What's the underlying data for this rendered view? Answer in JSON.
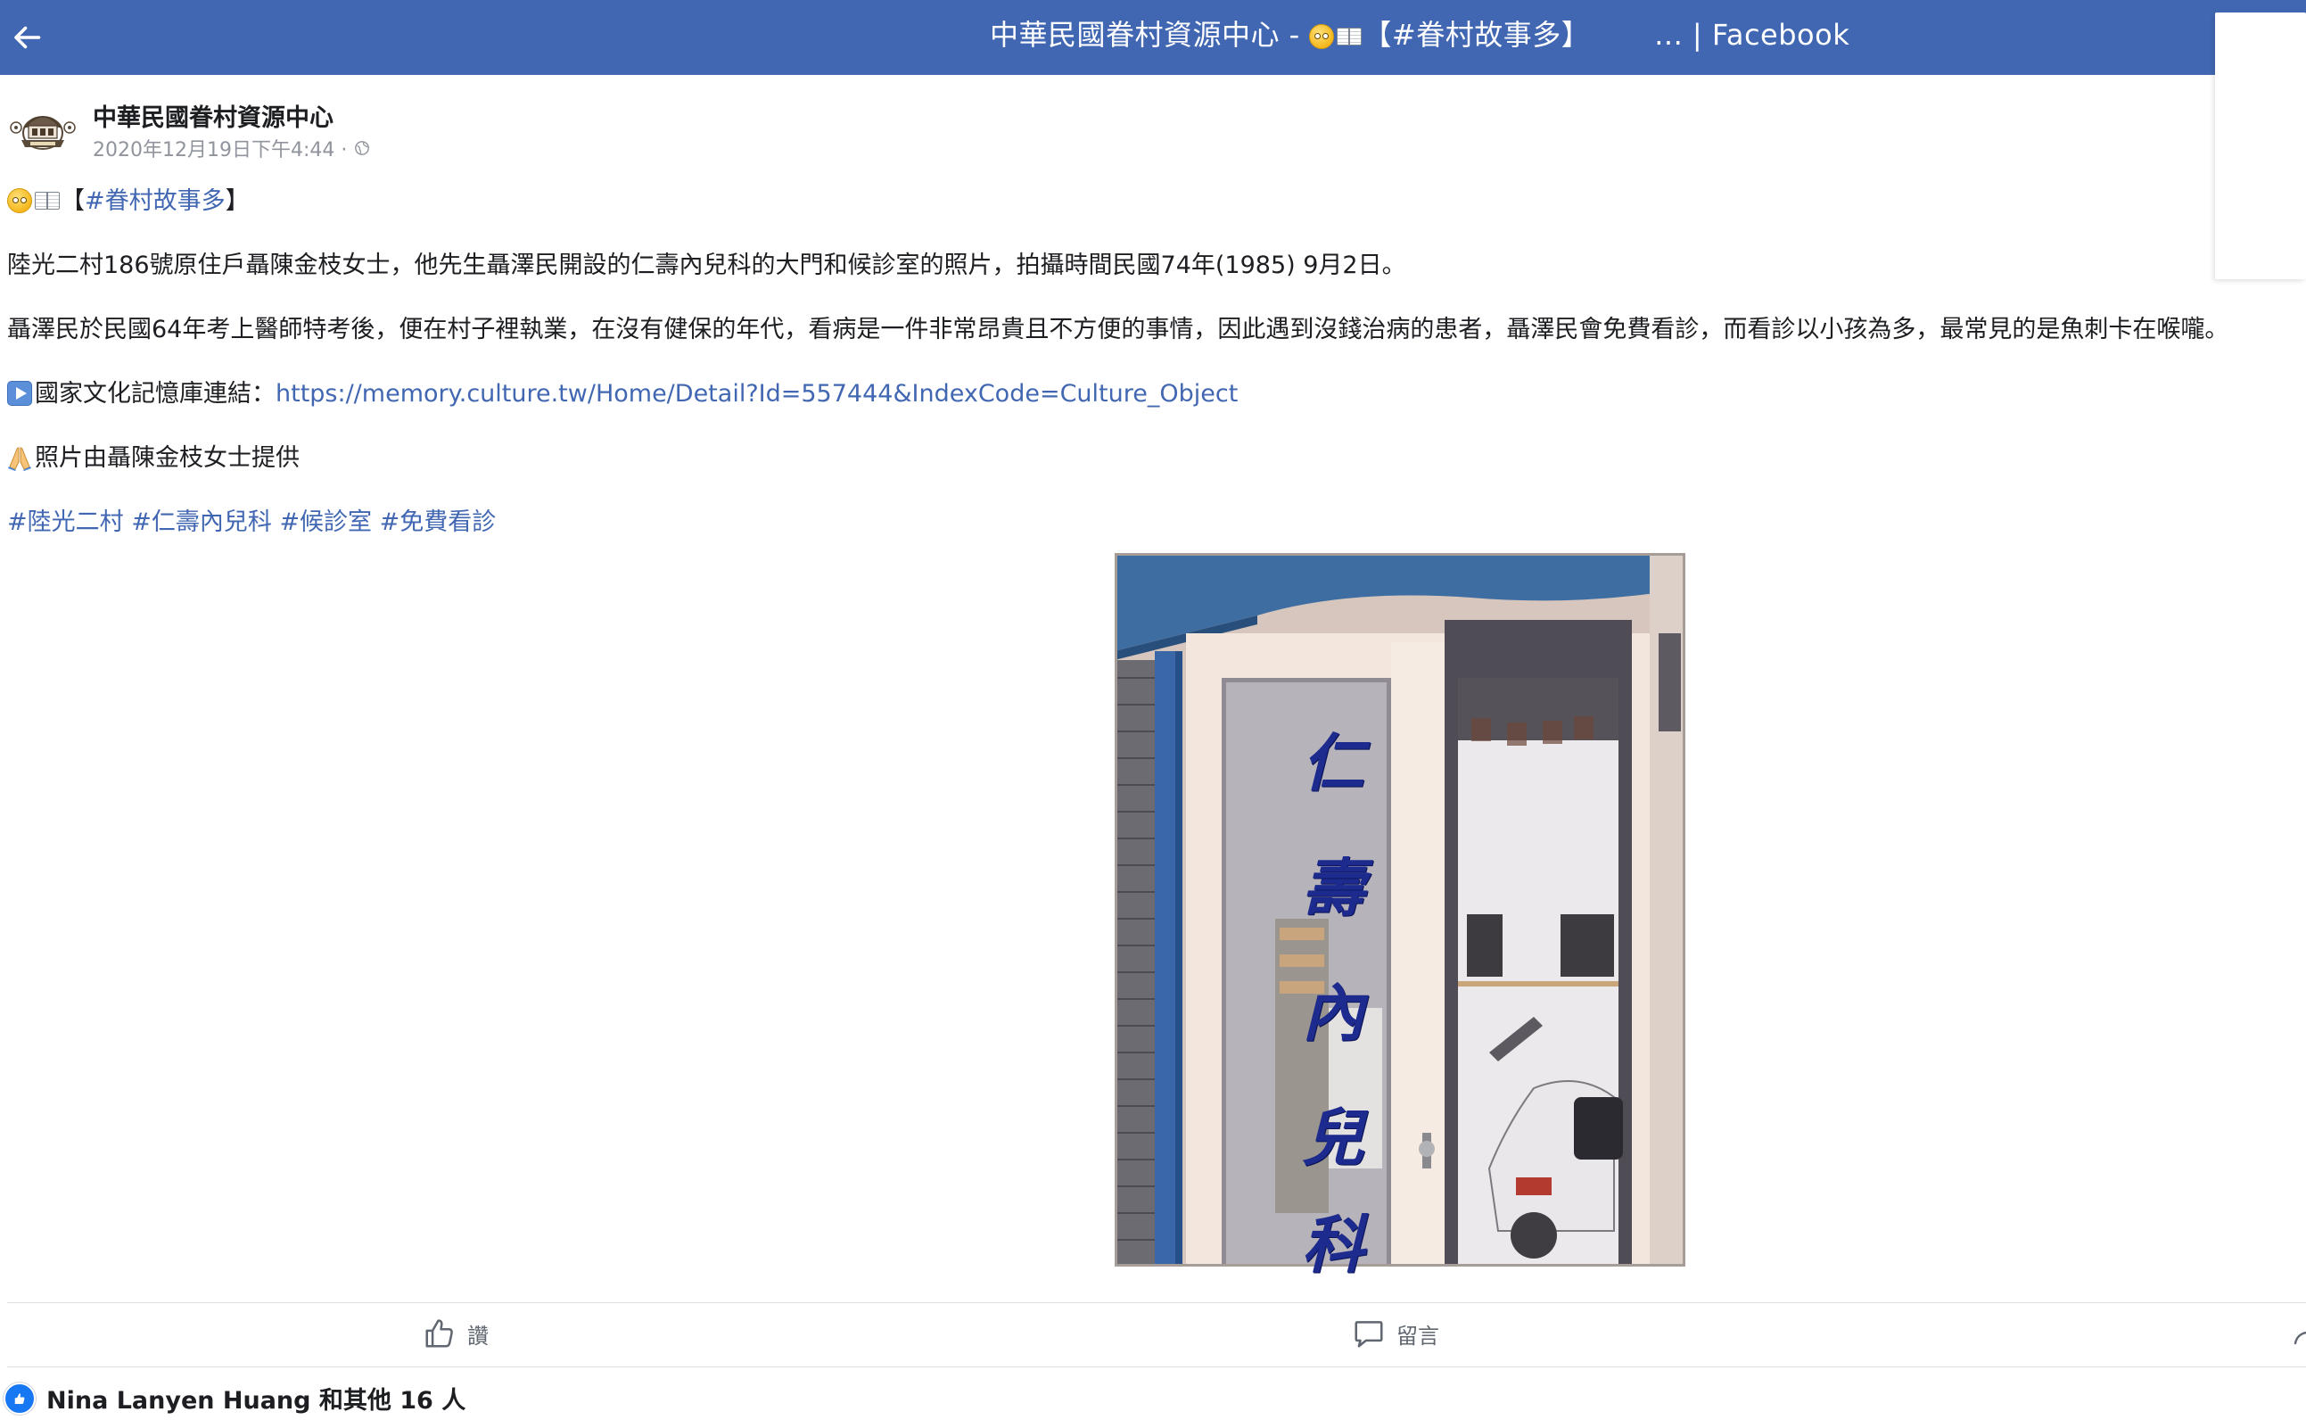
{
  "topbar": {
    "title_prefix": "中華民國眷村資源中心 - ",
    "title_tag": "【#眷村故事多】",
    "title_suffix": "... | Facebook"
  },
  "post": {
    "page_name": "中華民國眷村資源中心",
    "timestamp": "2020年12月19日下午4:44 ·",
    "visibility_icon": "globe-icon",
    "header_tag_open": "【",
    "header_tag_link": "#眷村故事多",
    "header_tag_close": "】",
    "paragraph_1": "陸光二村186號原住戶聶陳金枝女士，他先生聶澤民開設的仁壽內兒科的大門和候診室的照片，拍攝時間民國74年(1985) 9月2日。",
    "paragraph_2": "聶澤民於民國64年考上醫師特考後，便在村子裡執業，在沒有健保的年代，看病是一件非常昂貴且不方便的事情，因此遇到沒錢治病的患者，聶澤民會免費看診，而看診以小孩為多，最常見的是魚刺卡在喉嚨。",
    "archive_label": "國家文化記憶庫連結：",
    "archive_url": "https://memory.culture.tw/Home/Detail?Id=557444&IndexCode=Culture_Object",
    "credit": "照片由聶陳金枝女士提供",
    "hashtags": [
      "#陸光二村",
      "#仁壽內兒科",
      "#候診室",
      "#免費看診"
    ],
    "photo_sign_chars": [
      "仁",
      "壽",
      "內",
      "兒",
      "科"
    ]
  },
  "actions": {
    "like_label": "讚",
    "comment_label": "留言"
  },
  "reactions": {
    "summary": "Nina Lanyen Huang 和其他 16 人"
  },
  "colors": {
    "facebook_blue": "#4267b2",
    "link": "#4267b2",
    "meta_gray": "#90949c",
    "reaction_blue": "#1877f2"
  }
}
